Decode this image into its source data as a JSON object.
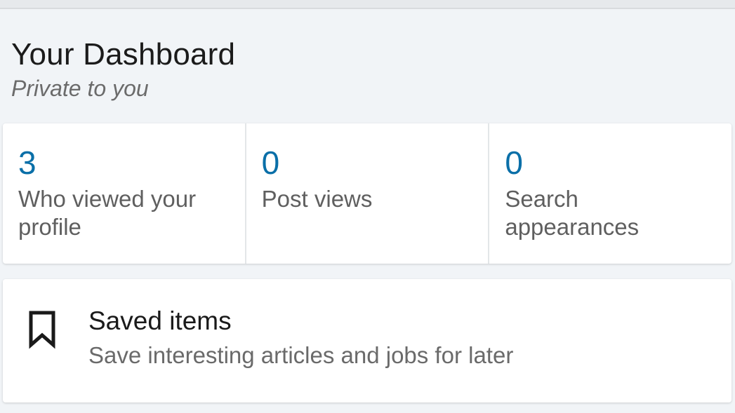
{
  "dashboard": {
    "title": "Your Dashboard",
    "subtitle": "Private to you"
  },
  "stats": [
    {
      "value": "3",
      "label": "Who viewed your profile"
    },
    {
      "value": "0",
      "label": "Post views"
    },
    {
      "value": "0",
      "label": "Search appearances"
    }
  ],
  "saved_items": {
    "icon": "bookmark-icon",
    "title": "Saved items",
    "description": "Save interesting articles and jobs for later"
  },
  "colors": {
    "accent": "#0a6fa8",
    "background": "#f1f4f7",
    "card": "#ffffff"
  }
}
